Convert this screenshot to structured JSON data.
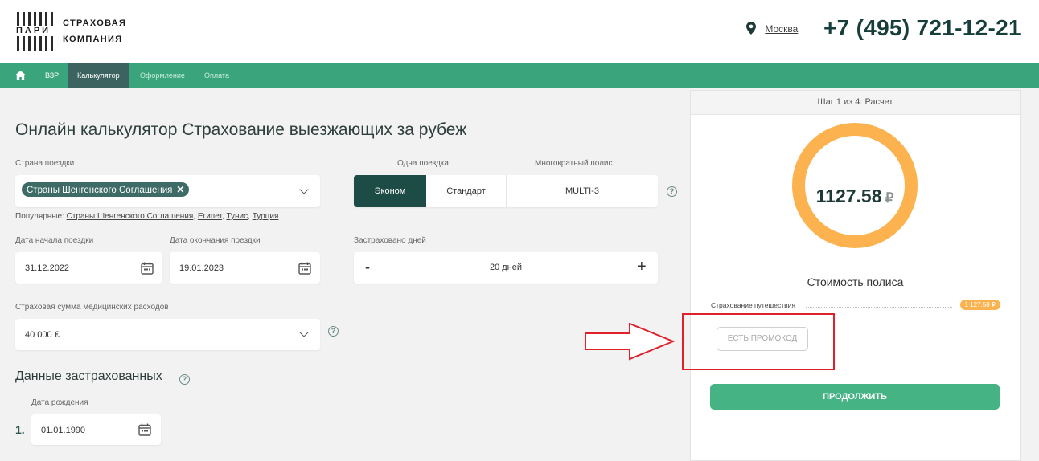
{
  "header": {
    "logo": {
      "word": "ПАРИ",
      "line1": "СТРАХОВАЯ",
      "line2": "КОМПАНИЯ"
    },
    "city": "Москва",
    "phone": "+7 (495) 721-12-21"
  },
  "nav": {
    "items": [
      {
        "label": "ВЗР"
      },
      {
        "label": "Калькулятор"
      },
      {
        "label": "Оформление"
      },
      {
        "label": "Оплата"
      }
    ]
  },
  "main": {
    "title": "Онлайн калькулятор Страхование выезжающих за рубеж",
    "country": {
      "label": "Страна поездки",
      "chip": "Страны Шенгенского Соглашения",
      "chip_remove": "✕",
      "popular_prefix": "Популярные:",
      "popular": [
        "Страны Шенгенского Соглашения",
        "Египет",
        "Тунис",
        "Турция"
      ]
    },
    "trip_type": {
      "single_label": "Одна поездка",
      "multi_label": "Многократный полис",
      "options": [
        "Эконом",
        "Стандарт",
        "MULTI-3"
      ],
      "selected": "Эконом"
    },
    "start_date": {
      "label": "Дата начала поездки",
      "value": "31.12.2022"
    },
    "end_date": {
      "label": "Дата окончания поездки",
      "value": "19.01.2023"
    },
    "days": {
      "label": "Застраховано дней",
      "minus": "-",
      "value": "20 дней",
      "plus": "+"
    },
    "sum": {
      "label": "Страховая сумма медицинских расходов",
      "value": "40 000 €"
    },
    "help_glyph": "?",
    "insured": {
      "title": "Данные застрахованных",
      "birth_label": "Дата рождения",
      "number": "1.",
      "birth_value": "01.01.1990"
    }
  },
  "panel": {
    "step": "Шаг 1 из 4: Расчет",
    "price": "1127.58",
    "currency": "₽",
    "cost_label": "Стоимость полиса",
    "item_label": "Страхование путешествия",
    "item_value": "1 127.58 ₽",
    "promo_button": "ЕСТЬ ПРОМОКОД",
    "continue_button": "ПРОДОЛЖИТЬ"
  },
  "colors": {
    "nav_green": "#3aa57c",
    "dark_teal": "#1d4b45",
    "orange": "#fcb24f",
    "button_green": "#46b384",
    "annotation_red": "#e0202a"
  },
  "icons": [
    "home-icon",
    "location-pin-icon",
    "calendar-icon",
    "chevron-down-icon",
    "help-icon",
    "close-icon",
    "arrow-annotation-icon"
  ]
}
